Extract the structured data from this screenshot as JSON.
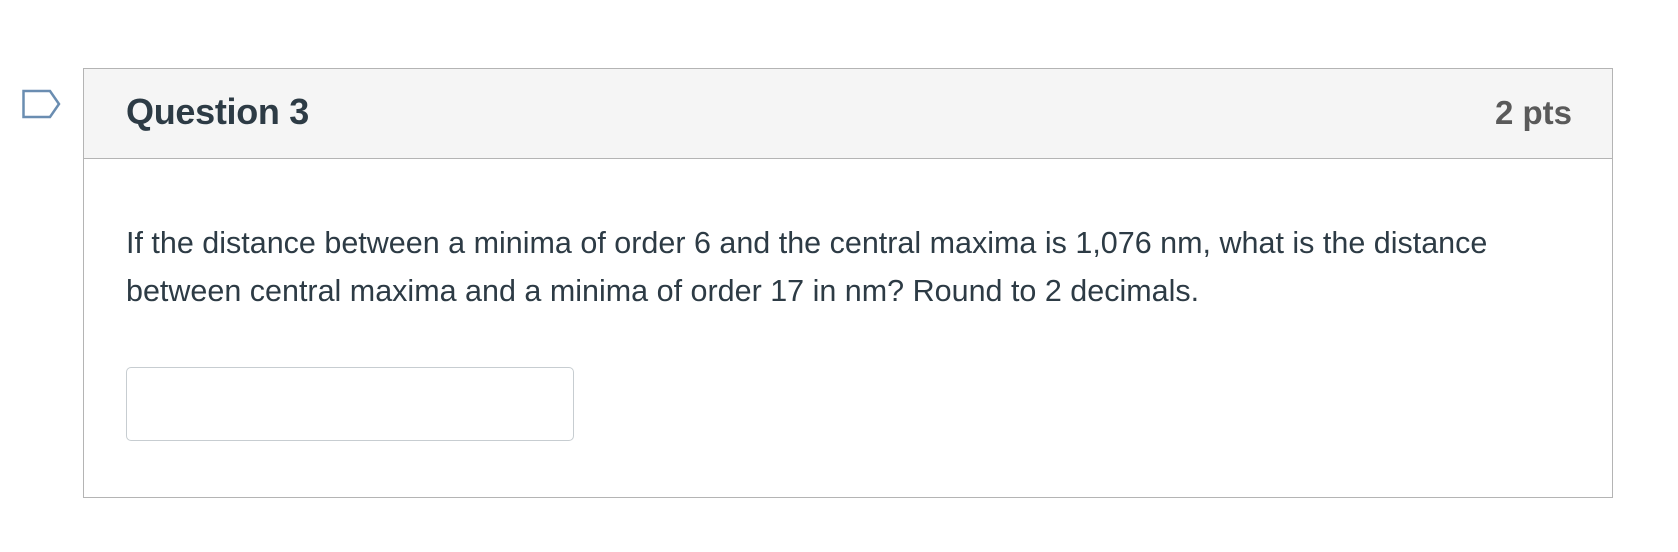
{
  "question": {
    "title": "Question 3",
    "points": "2 pts",
    "text": "If the distance between a minima of order 6  and the central maxima is 1,076 nm, what is the distance between central maxima and a minima of order 17 in nm? Round to 2 decimals.",
    "answer": {
      "value": "",
      "placeholder": ""
    }
  },
  "icons": {
    "flag": "flag-question-icon"
  },
  "colors": {
    "header_bg": "#f5f5f5",
    "border": "#b4b4b4",
    "text": "#2d3b45",
    "points_text": "#5a5a5a",
    "flag_stroke": "#6a8db1"
  }
}
